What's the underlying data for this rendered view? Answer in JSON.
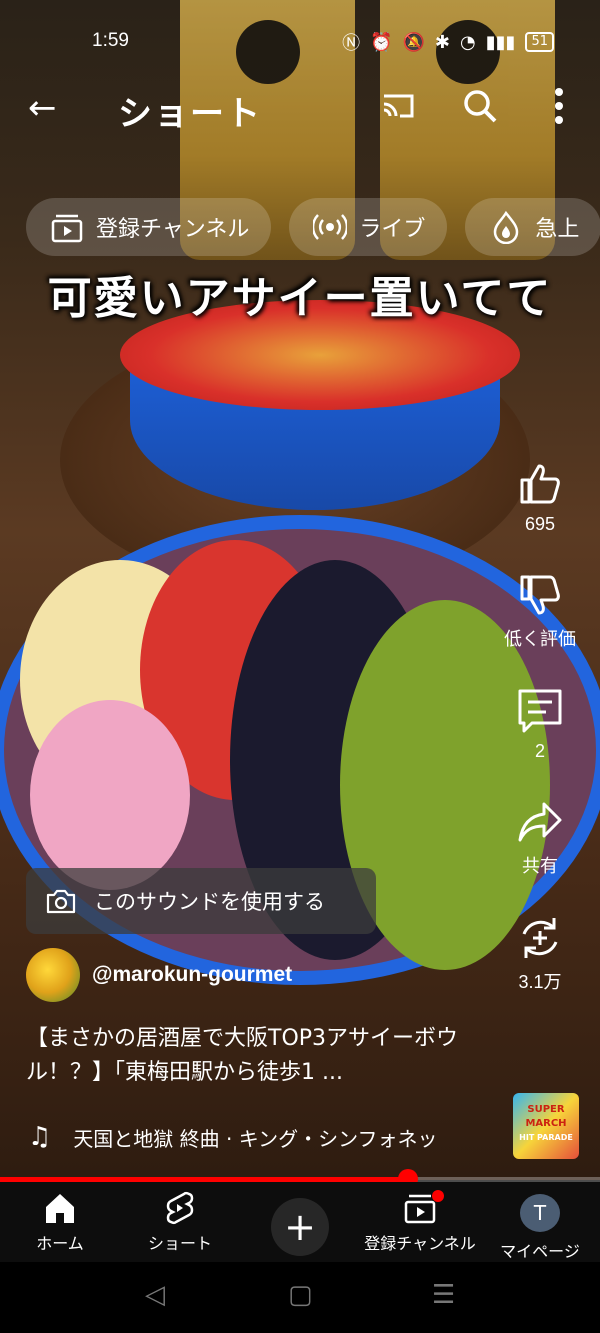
{
  "status_bar": {
    "time": "1:59",
    "battery": "51"
  },
  "app_bar": {
    "title": "ショート"
  },
  "chips": [
    {
      "label": "登録チャンネル",
      "icon": "subscriptions-icon"
    },
    {
      "label": "ライブ",
      "icon": "live-icon"
    },
    {
      "label": "急上",
      "icon": "trending-icon"
    }
  ],
  "caption": "可愛いアサイー置いてて",
  "actions": {
    "like_count": "695",
    "dislike_label": "低く評価",
    "comments_count": "2",
    "share_label": "共有",
    "remix_count": "3.1万"
  },
  "sound_button": {
    "label": "このサウンドを使用する"
  },
  "channel": {
    "handle": "@marokun-gourmet"
  },
  "video_title": "【まさかの居酒屋で大阪TOP3アサイーボウル！？】「東梅田駅から徒歩1 ...",
  "music": {
    "track": "天国と地獄 終曲 · キング・シンフォネッ"
  },
  "album_art_text": [
    "SUPER",
    "MARCH",
    "HIT PARADE"
  ],
  "progress": {
    "fraction": 0.68
  },
  "bottom_nav": {
    "home": "ホーム",
    "shorts": "ショート",
    "subscriptions": "登録チャンネル",
    "me": "マイページ",
    "me_initial": "T"
  }
}
